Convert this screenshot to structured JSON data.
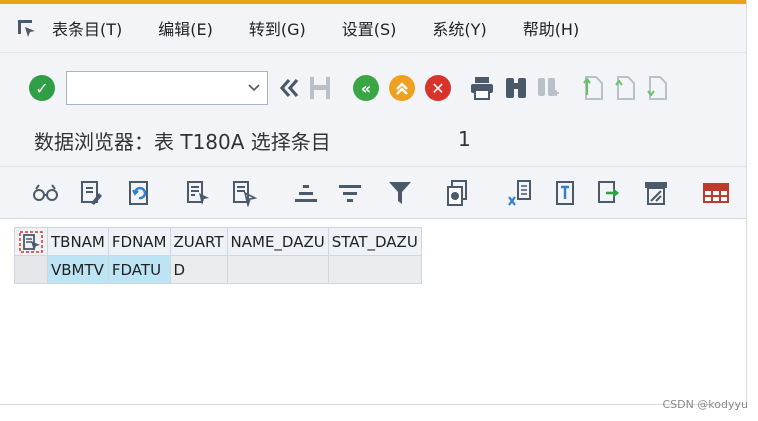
{
  "menubar": {
    "items": [
      "表条目(T)",
      "编辑(E)",
      "转到(G)",
      "设置(S)",
      "系统(Y)",
      "帮助(H)"
    ]
  },
  "toolbar": {
    "command_field_value": "",
    "icons": [
      "enter-icon",
      "back-double-icon",
      "save-icon",
      "back-icon",
      "exit-icon",
      "cancel-icon",
      "print-icon",
      "find-icon",
      "find-next-icon",
      "first-page-icon",
      "previous-page-icon",
      "next-page-icon"
    ]
  },
  "title": {
    "text": "数据浏览器：表 T180A 选择条目",
    "count": "1"
  },
  "app_toolbar": {
    "icons": [
      "display-icon",
      "change-icon",
      "refresh-icon",
      "select-all-icon",
      "deselect-all-icon",
      "sort-ascending-icon",
      "sort-descending-icon",
      "filter-icon",
      "total-icon",
      "export-excel-icon",
      "local-file-icon",
      "print-preview-icon",
      "view-icon",
      "layout-grid-icon"
    ]
  },
  "grid": {
    "columns": [
      "TBNAM",
      "FDNAM",
      "ZUART",
      "NAME_DAZU",
      "STAT_DAZU"
    ],
    "rows": [
      [
        "VBMTV",
        "FDATU",
        "D",
        "",
        ""
      ]
    ]
  },
  "watermark": "CSDN @kodyyu",
  "colors": {
    "accent_line": "#e8a31d",
    "enter_green": "#2f9e44",
    "nav_green": "#3aa545",
    "nav_orange": "#f0a020",
    "cancel_red": "#d9342b",
    "key_cell_blue": "#bde4f4"
  }
}
